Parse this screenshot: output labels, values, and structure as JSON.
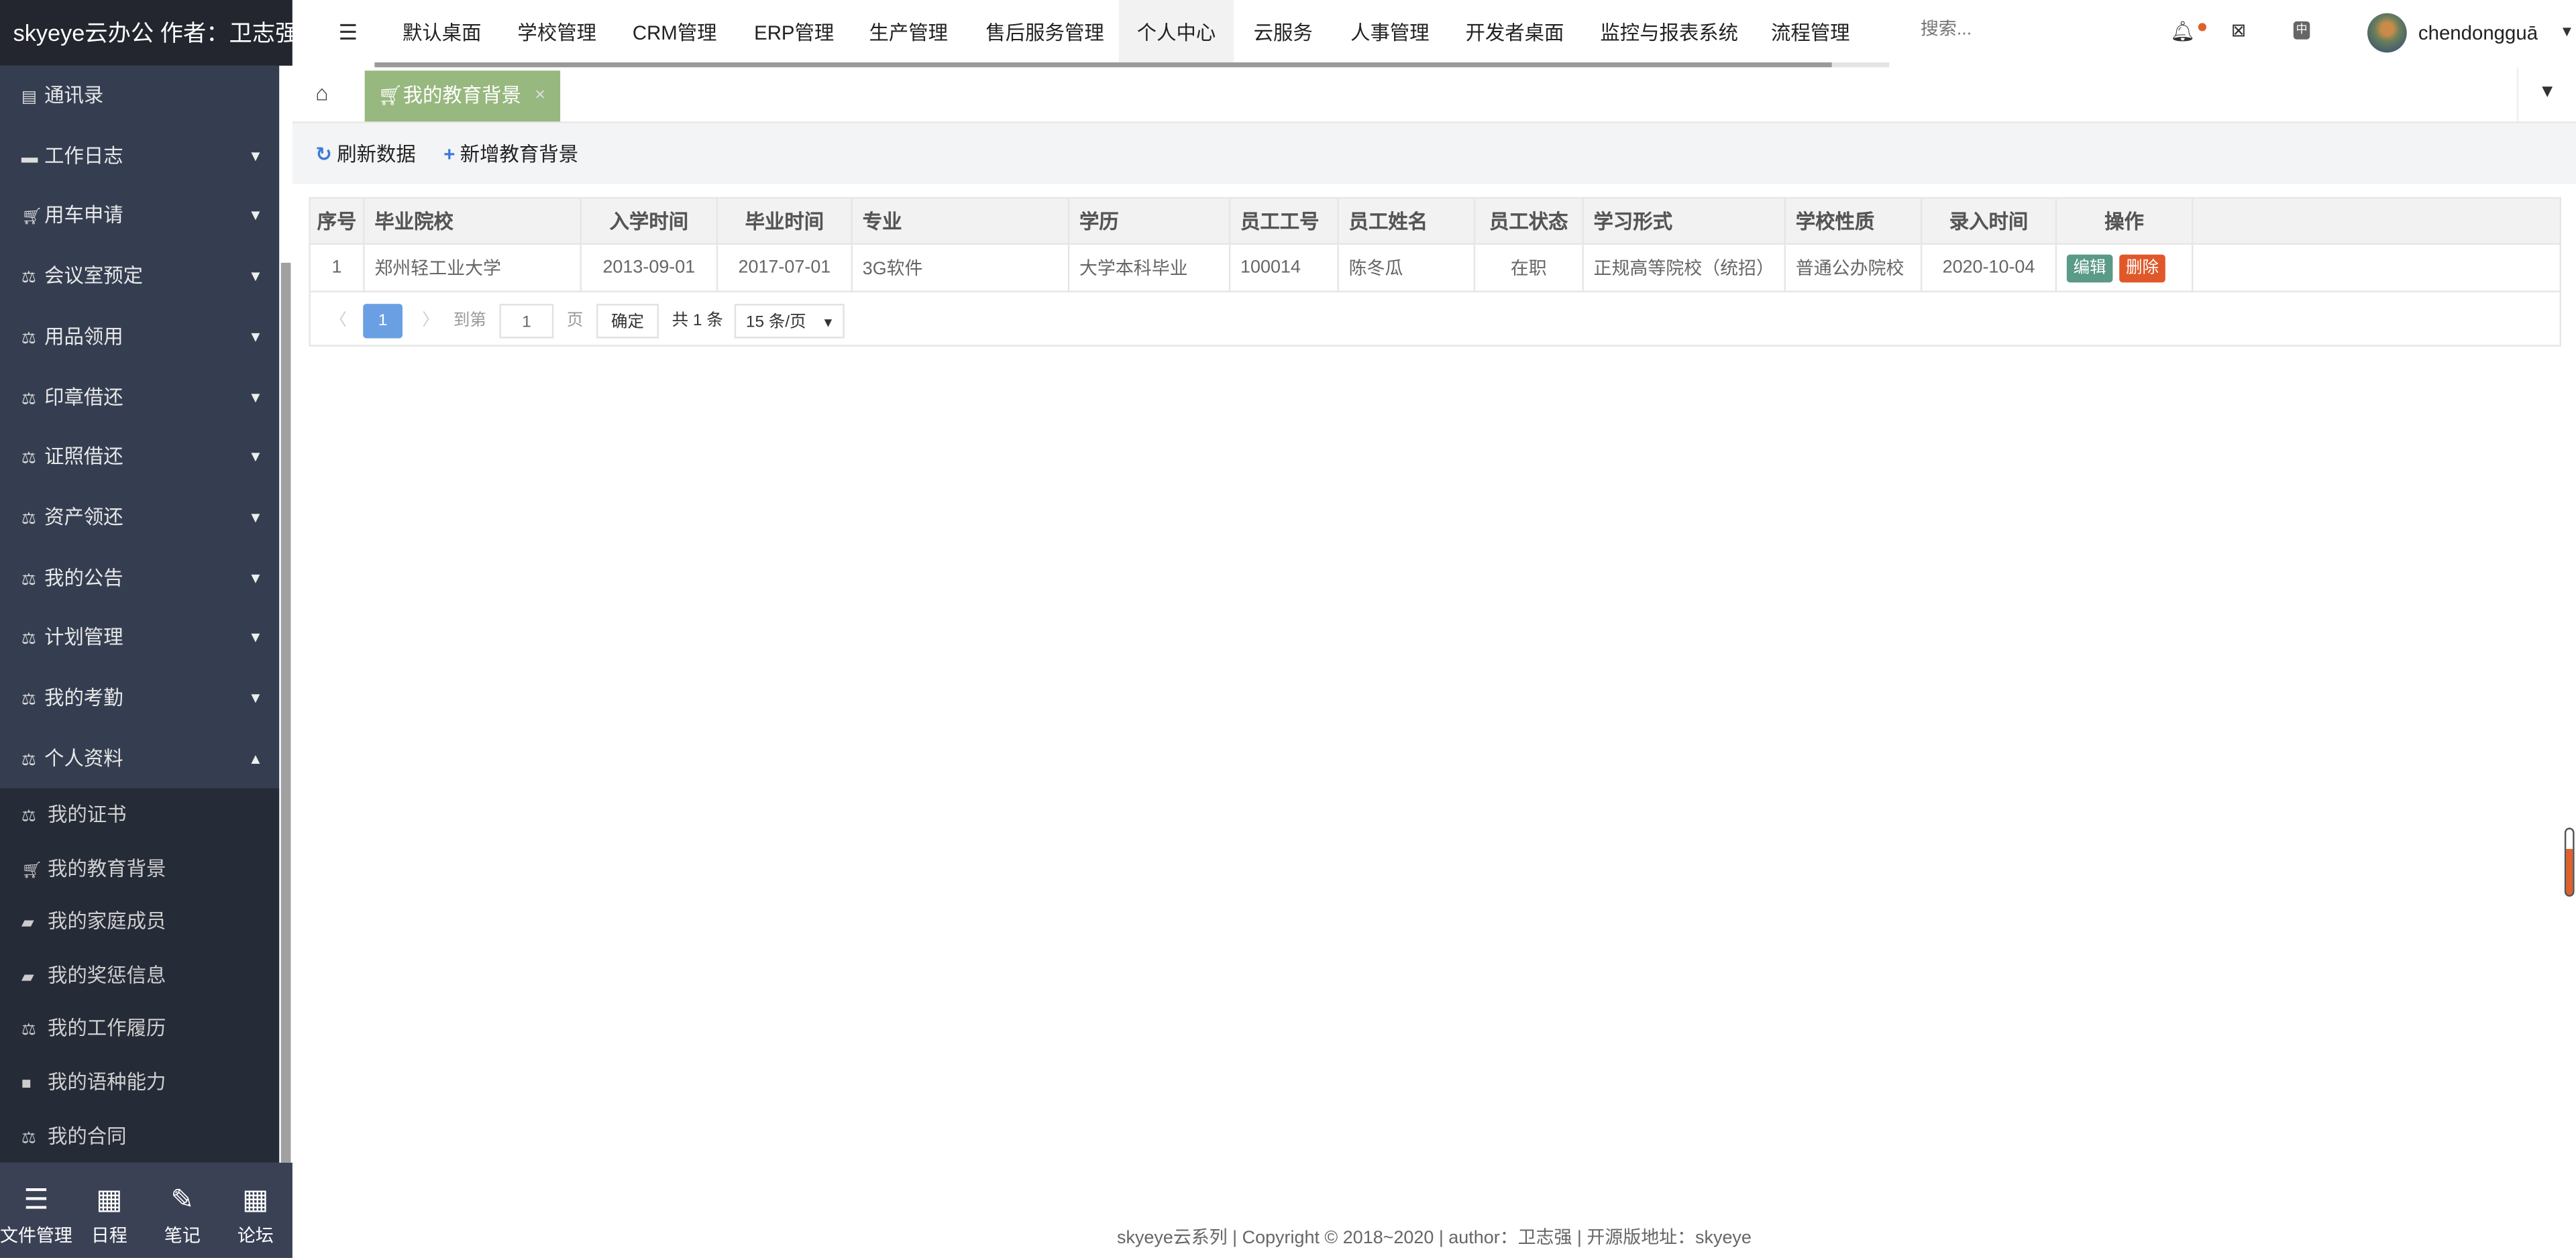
{
  "app": {
    "title": "skyeye云办公 作者：卫志强"
  },
  "topnav": {
    "items": [
      "默认桌面",
      "学校管理",
      "CRM管理",
      "ERP管理",
      "生产管理",
      "售后服务管理",
      "个人中心",
      "云服务",
      "人事管理",
      "开发者桌面",
      "监控与报表系统",
      "流程管理"
    ],
    "active": "个人中心",
    "search_placeholder": "搜索...",
    "username": "chendongguā",
    "user_caret": "▼"
  },
  "sidebar": {
    "items": [
      {
        "label": "通讯录",
        "icon": "address-book-icon",
        "arrow": ""
      },
      {
        "label": "工作日志",
        "icon": "archive-icon",
        "arrow": "▼"
      },
      {
        "label": "用车申请",
        "icon": "cart-icon",
        "arrow": "▼"
      },
      {
        "label": "会议室预定",
        "icon": "balance-icon",
        "arrow": "▼"
      },
      {
        "label": "用品领用",
        "icon": "balance-icon",
        "arrow": "▼"
      },
      {
        "label": "印章借还",
        "icon": "balance-icon",
        "arrow": "▼"
      },
      {
        "label": "证照借还",
        "icon": "balance-icon",
        "arrow": "▼"
      },
      {
        "label": "资产领还",
        "icon": "balance-icon",
        "arrow": "▼"
      },
      {
        "label": "我的公告",
        "icon": "balance-icon",
        "arrow": "▼"
      },
      {
        "label": "计划管理",
        "icon": "balance-icon",
        "arrow": "▼"
      },
      {
        "label": "我的考勤",
        "icon": "balance-icon",
        "arrow": "▼"
      },
      {
        "label": "个人资料",
        "icon": "balance-icon",
        "arrow": "▲"
      }
    ],
    "subitems": [
      {
        "label": "我的证书",
        "icon": "balance-icon"
      },
      {
        "label": "我的教育背景",
        "icon": "cart-icon"
      },
      {
        "label": "我的家庭成员",
        "icon": "folder-open-icon"
      },
      {
        "label": "我的奖惩信息",
        "icon": "folder-open-icon"
      },
      {
        "label": "我的工作履历",
        "icon": "balance-icon"
      },
      {
        "label": "我的语种能力",
        "icon": "folder-icon"
      },
      {
        "label": "我的合同",
        "icon": "balance-icon"
      }
    ],
    "bottom": [
      {
        "label": "文件管理",
        "icon": "list-icon"
      },
      {
        "label": "日程",
        "icon": "calendar-icon"
      },
      {
        "label": "笔记",
        "icon": "edit-icon"
      },
      {
        "label": "论坛",
        "icon": "calendar-icon"
      }
    ]
  },
  "tabs": {
    "active": "我的教育背景",
    "close": "×",
    "menu": "▼"
  },
  "toolbar": {
    "refresh": "刷新数据",
    "add": "新增教育背景"
  },
  "table": {
    "headers": [
      "序号",
      "毕业院校",
      "入学时间",
      "毕业时间",
      "专业",
      "学历",
      "员工工号",
      "员工姓名",
      "员工状态",
      "学习形式",
      "学校性质",
      "录入时间",
      "操作"
    ],
    "rows": [
      [
        "1",
        "郑州轻工业大学",
        "2013-09-01",
        "2017-07-01",
        "3G软件",
        "大学本科毕业",
        "100014",
        "陈冬瓜",
        "在职",
        "正规高等院校（统招）",
        "普通公办院校",
        "2020-10-04"
      ]
    ],
    "edit": "编辑",
    "delete": "删除",
    "edit_color": "#5a9a86",
    "delete_color": "#e0582a"
  },
  "pager": {
    "prev": "〈",
    "current": "1",
    "next": "〉",
    "goto": "到第",
    "page_value": "1",
    "page_unit": "页",
    "confirm": "确定",
    "total": "共 1 条",
    "page_size": "15 条/页",
    "size_caret": "▼"
  },
  "footer": "skyeye云系列 | Copyright © 2018~2020 | author：卫志强 | 开源版地址：skyeye"
}
